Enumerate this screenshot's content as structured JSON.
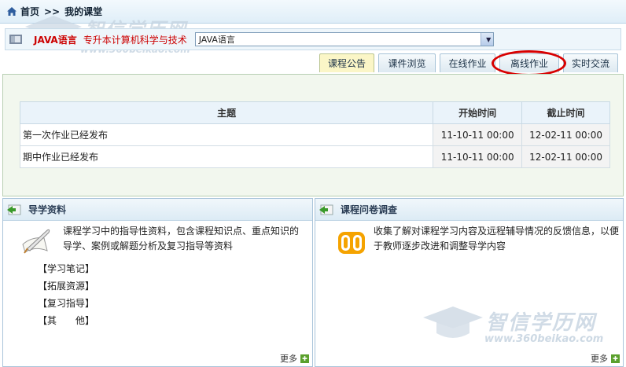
{
  "breadcrumb": {
    "home": "首页",
    "separator": ">>",
    "current": "我的课堂"
  },
  "watermark": {
    "brand": "智信学历网",
    "url": "www.360beikao.com"
  },
  "course": {
    "name": "JAVA语言",
    "major": "专升本计算机科学与技术",
    "selected": "JAVA语言"
  },
  "tabs": [
    {
      "label": "课程公告",
      "active": true
    },
    {
      "label": "课件浏览",
      "active": false
    },
    {
      "label": "在线作业",
      "active": false
    },
    {
      "label": "离线作业",
      "active": false
    },
    {
      "label": "实时交流",
      "active": false
    }
  ],
  "announcements": {
    "headers": {
      "title": "主题",
      "start": "开始时间",
      "end": "截止时间"
    },
    "rows": [
      {
        "title": "第一次作业已经发布",
        "start": "11-10-11 00:00",
        "end": "12-02-11 00:00"
      },
      {
        "title": "期中作业已经发布",
        "start": "11-10-11 00:00",
        "end": "12-02-11 00:00"
      }
    ]
  },
  "guide": {
    "title": "导学资料",
    "description": "课程学习中的指导性资料，包含课程知识点、重点知识的导学、案例或解题分析及复习指导等资料",
    "items": [
      "【学习笔记】",
      "【拓展资源】",
      "【复习指导】",
      "【其　　他】"
    ],
    "more": "更多"
  },
  "survey": {
    "title": "课程问卷调查",
    "description": "收集了解对课程学习内容及远程辅导情况的反馈信息，以便于教师逐步改进和调整导学内容",
    "more": "更多"
  },
  "colors": {
    "accent_red": "#cc0000",
    "annotation_circle": "#d80000",
    "active_tab": "#fbf6c7"
  }
}
